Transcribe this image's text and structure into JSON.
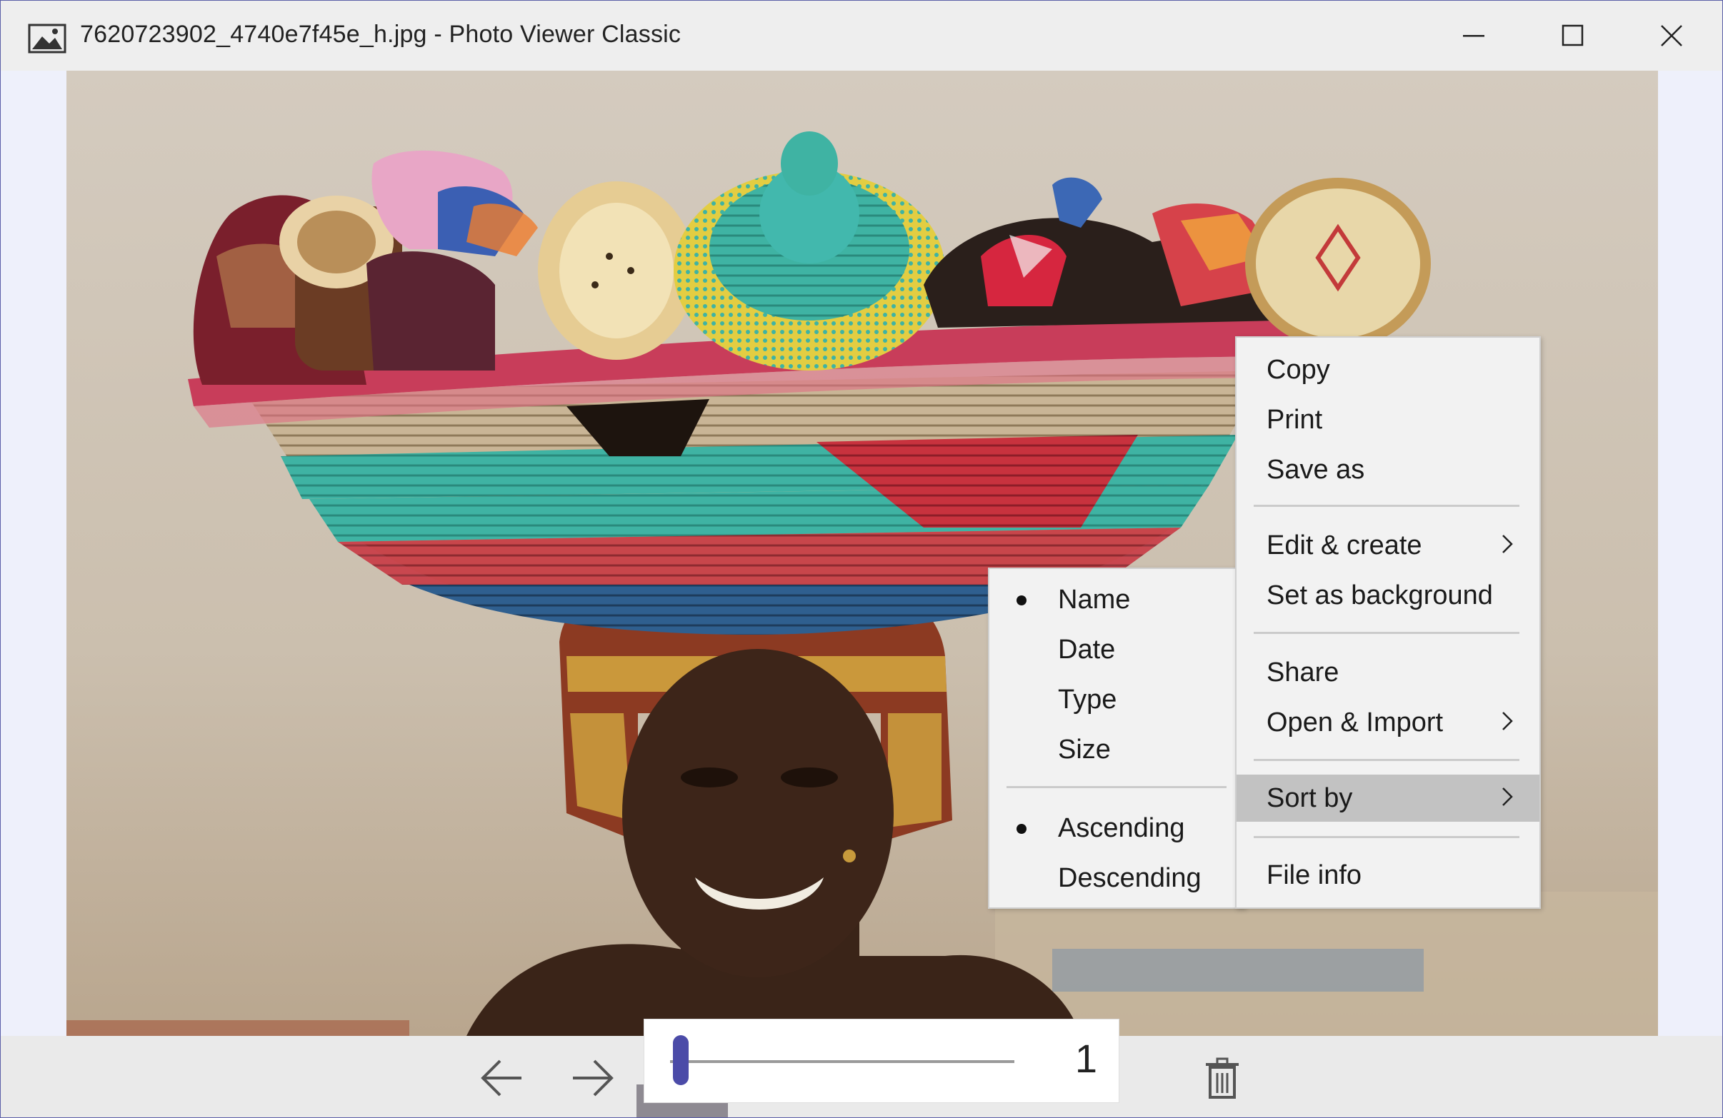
{
  "window": {
    "title": "7620723902_4740e7f45e_h.jpg - Photo Viewer Classic",
    "icon": "image-icon",
    "controls": [
      "minimize-icon",
      "maximize-icon",
      "close-icon"
    ]
  },
  "context_menu": {
    "items": [
      {
        "label": "Copy"
      },
      {
        "label": "Print"
      },
      {
        "label": "Save as"
      },
      {
        "label": "Edit & create",
        "submenu": true
      },
      {
        "label": "Set as background"
      },
      {
        "label": "Share"
      },
      {
        "label": "Open & Import",
        "submenu": true
      },
      {
        "label": "Sort by",
        "submenu": true,
        "highlighted": true
      },
      {
        "label": "File info"
      }
    ]
  },
  "sort_submenu": {
    "items": [
      {
        "label": "Name",
        "selected": true
      },
      {
        "label": "Date",
        "selected": false
      },
      {
        "label": "Type",
        "selected": false
      },
      {
        "label": "Size",
        "selected": false
      },
      {
        "label": "Ascending",
        "selected": true
      },
      {
        "label": "Descending",
        "selected": false
      }
    ]
  },
  "toolbar": {
    "prev_icon": "arrow-left-icon",
    "next_icon": "arrow-right-icon",
    "zoom_value": "1",
    "zoom_level": 0,
    "delete_icon": "trash-icon"
  },
  "colors": {
    "accent": "#4b4ba8",
    "menu_bg": "#f2f2f2",
    "menu_highlight": "#c2c2c2",
    "window_border": "#5b5fa8"
  }
}
